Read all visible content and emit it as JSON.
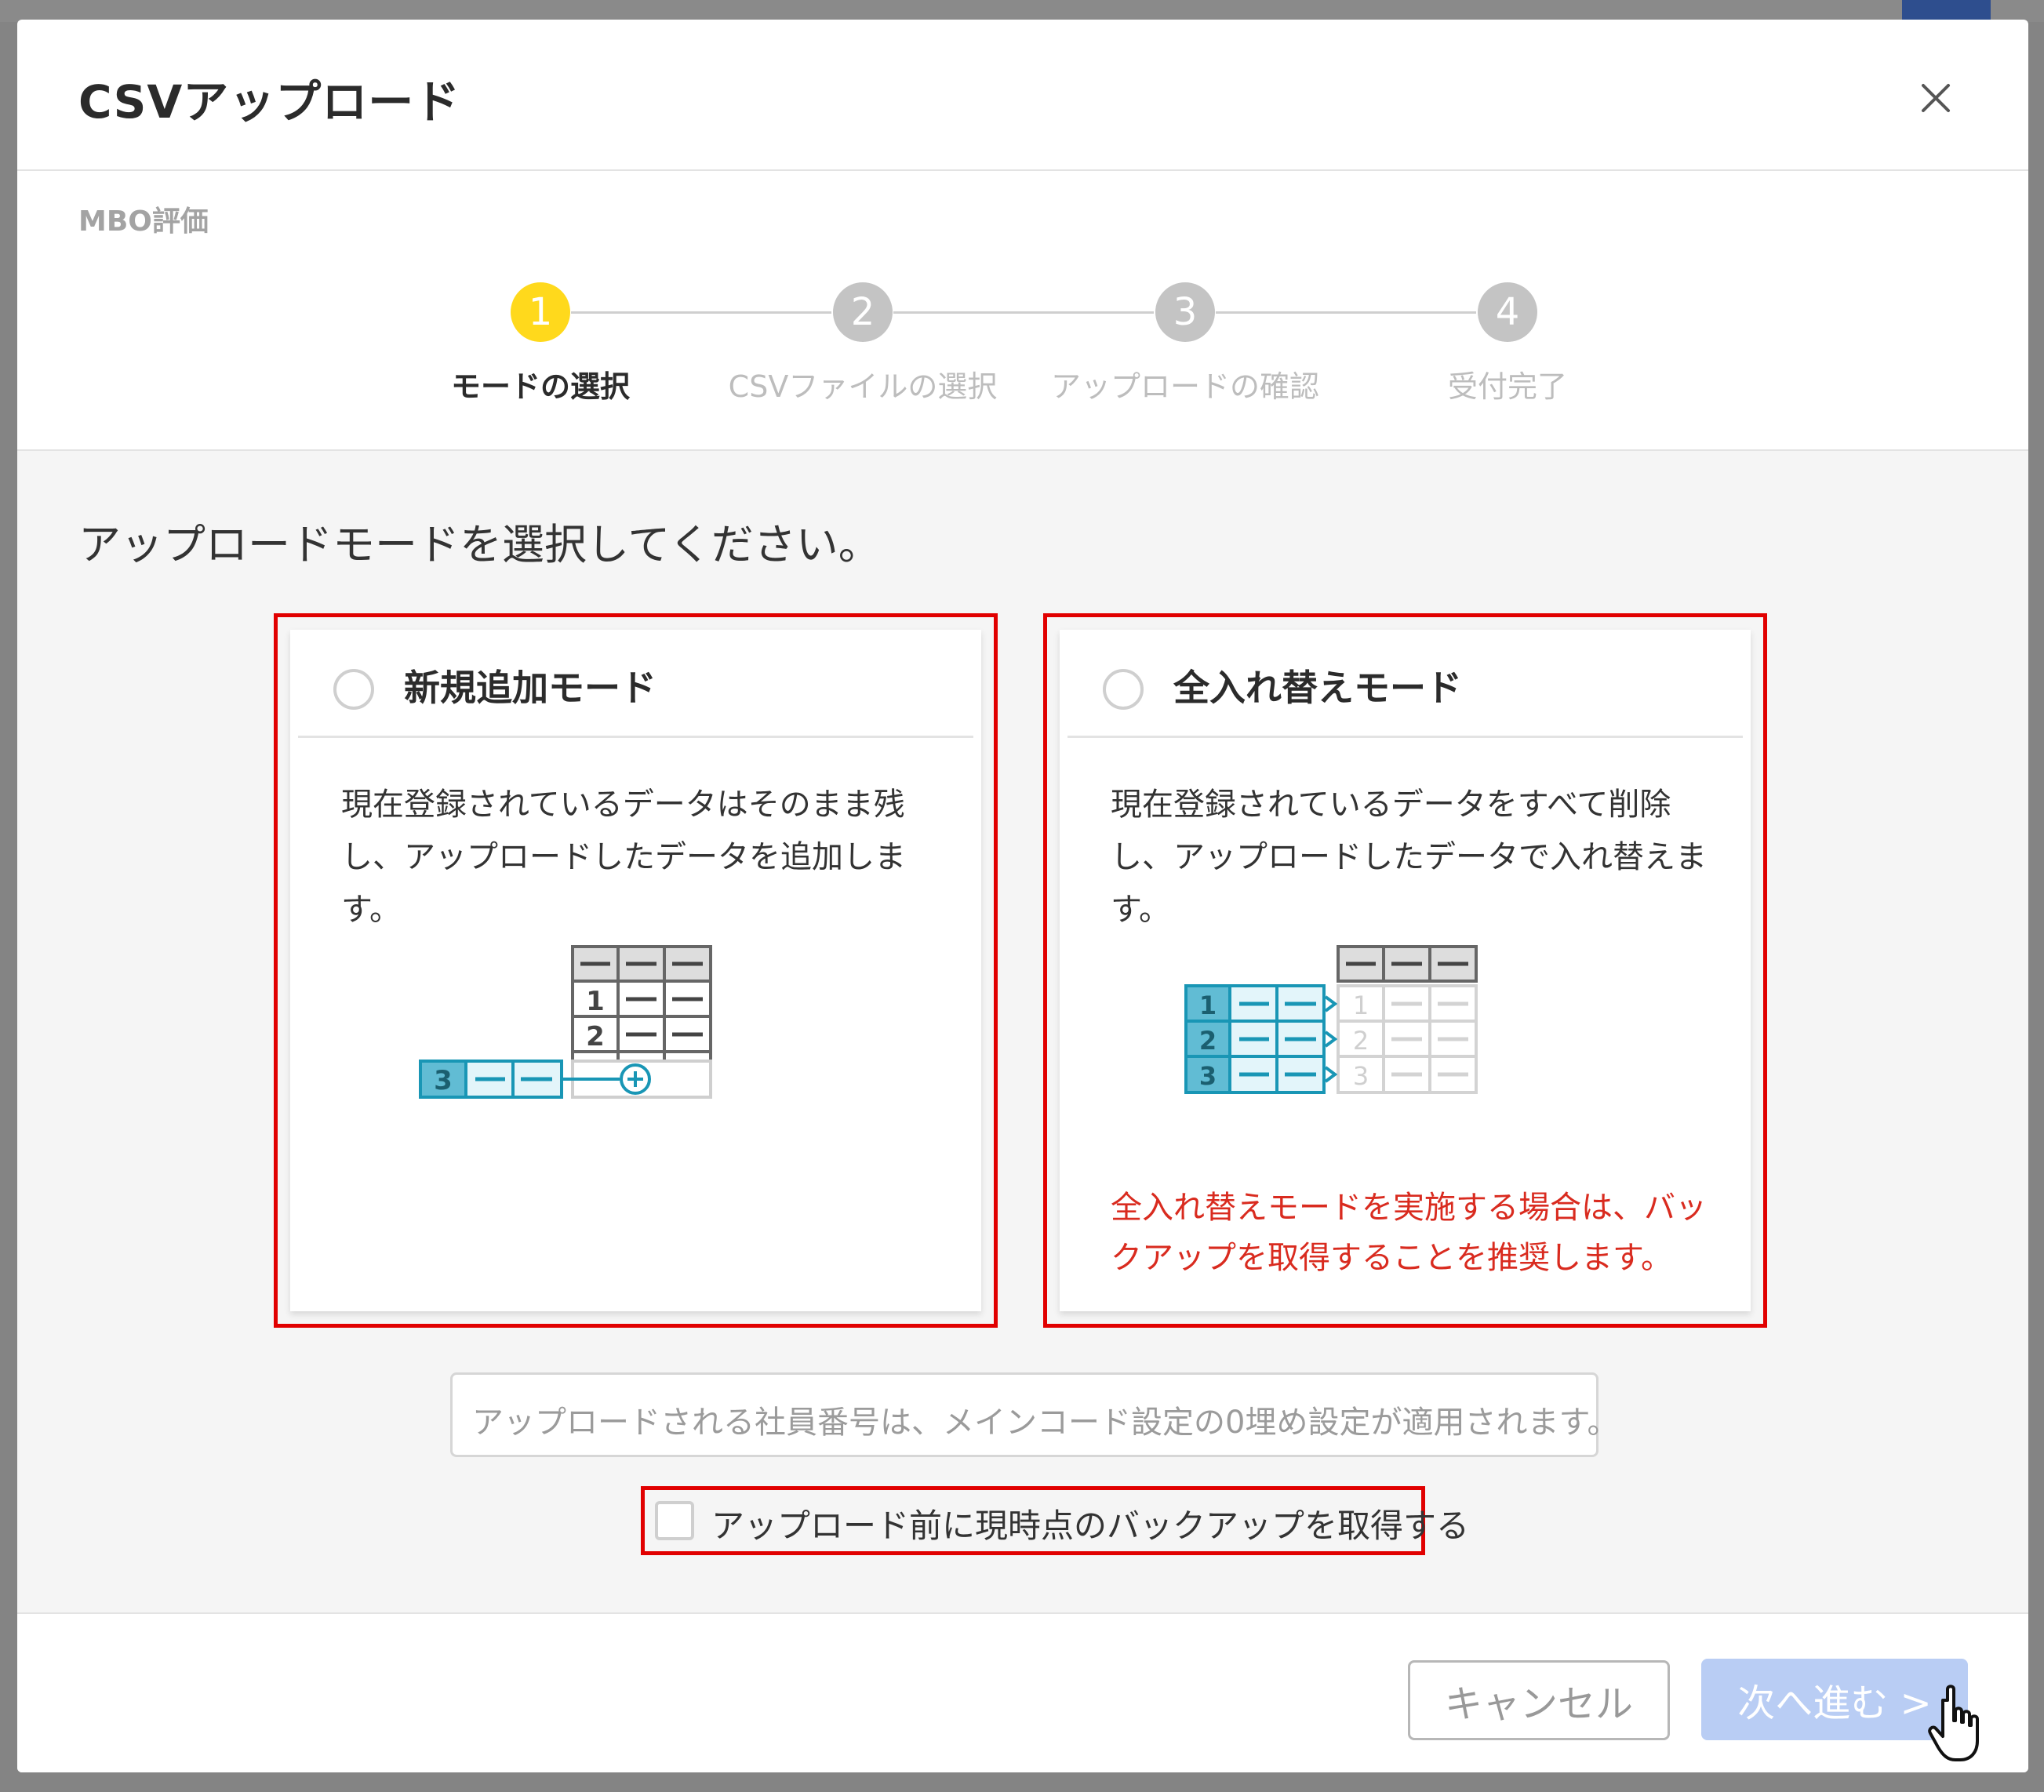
{
  "modal": {
    "title": "CSVアップロード",
    "breadcrumb": "MBO評価"
  },
  "stepper": {
    "steps": [
      {
        "number": "1",
        "label": "モードの選択",
        "state": "active"
      },
      {
        "number": "2",
        "label": "CSVファイルの選択",
        "state": "inactive"
      },
      {
        "number": "3",
        "label": "アップロードの確認",
        "state": "inactive"
      },
      {
        "number": "4",
        "label": "受付完了",
        "state": "inactive"
      }
    ]
  },
  "body": {
    "instruction": "アップロードモードを選択してください。",
    "modes": [
      {
        "title": "新規追加モード",
        "description": "現在登録されているデータはそのまま残し、アップロードしたデータを追加します。",
        "selected": false
      },
      {
        "title": "全入れ替えモード",
        "description": "現在登録されているデータをすべて削除し、アップロードしたデータで入れ替えます。",
        "warning": "全入れ替えモードを実施する場合は、バックアップを取得することを推奨します。",
        "selected": false
      }
    ],
    "notice": "アップロードされる社員番号は、メインコード設定の0埋め設定が適用されます。",
    "backup_checkbox": {
      "label": "アップロード前に現時点のバックアップを取得する",
      "checked": false
    }
  },
  "footer": {
    "cancel_label": "キャンセル",
    "next_label": "次へ進む >"
  },
  "illustration": {
    "add_rows": [
      "1",
      "2",
      "3"
    ],
    "replace_rows": [
      "1",
      "2",
      "3"
    ]
  },
  "colors": {
    "highlight_frame": "#e10000",
    "step_active": "#ffd91c",
    "step_inactive": "#c4c4c4",
    "accent_teal": "#1996b5",
    "warning_text": "#d92b1f",
    "next_button_disabled": "#b9cdf4"
  }
}
